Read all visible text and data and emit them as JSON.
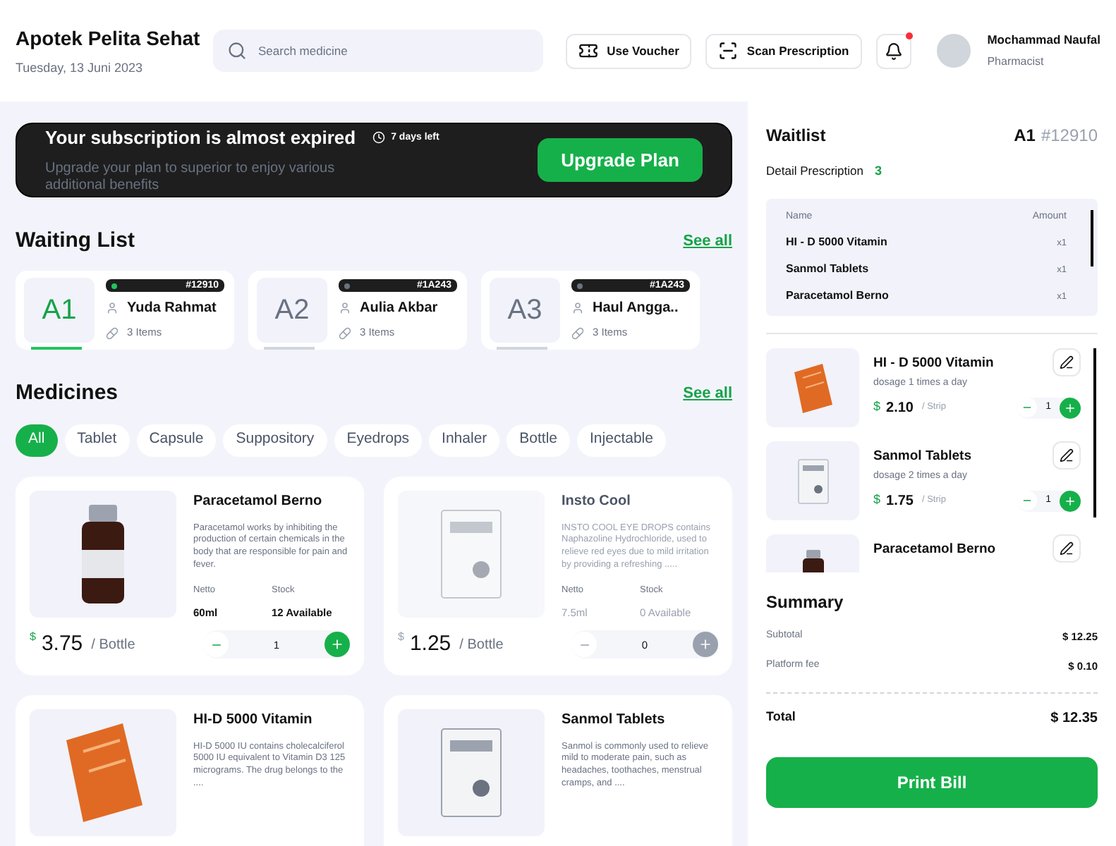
{
  "header": {
    "title": "Apotek Pelita Sehat",
    "date": "Tuesday, 13 Juni 2023",
    "search": {
      "placeholder": "Search medicine"
    },
    "buttons": [
      {
        "kind": "voucher",
        "label": "Use Voucher"
      },
      {
        "kind": "scan",
        "label": "Scan Prescription"
      }
    ],
    "notification": {
      "unread": true
    },
    "user": {
      "name": "Mochammad Naufal",
      "role": "Pharmacist"
    }
  },
  "banner": {
    "title": "Your subscription is almost expired",
    "days_left": "7 days left",
    "text": "Upgrade your plan to superior to enjoy various additional benefits",
    "button": "Upgrade Plan"
  },
  "waiting_list": {
    "title": "Waiting List",
    "see_all": "See all",
    "items": [
      {
        "queue": "A1",
        "code": "#12910",
        "name": "Yuda Rahmat",
        "items": "3 Items",
        "selected": true,
        "color": "#22c55e"
      },
      {
        "queue": "A2",
        "code": "#1A243",
        "name": "Aulia Akbar",
        "items": "3 Items",
        "selected": false,
        "color": "#6b7280"
      },
      {
        "queue": "A3",
        "code": "#1A243",
        "name": "Haul Angga..",
        "items": "3 Items",
        "selected": false,
        "color": "#6b7280"
      }
    ]
  },
  "medicines": {
    "title": "Medicines",
    "see_all": "See all",
    "categories": [
      {
        "label": "All",
        "selected": true
      },
      {
        "label": "Tablet",
        "selected": false
      },
      {
        "label": "Capsule",
        "selected": false
      },
      {
        "label": "Suppository",
        "selected": false
      },
      {
        "label": "Eyedrops",
        "selected": false
      },
      {
        "label": "Inhaler",
        "selected": false
      },
      {
        "label": "Bottle",
        "selected": false
      },
      {
        "label": "Injectable",
        "selected": false
      }
    ],
    "items": [
      {
        "kind": "bottle",
        "name": "Paracetamol Berno",
        "description": "Paracetamol works by inhibiting the production of certain chemicals in the body that are responsible for pain and fever.",
        "netto_label": "Netto",
        "netto": "60ml",
        "stock_label": "Stock",
        "stock": "12 Available",
        "currency": "$",
        "price": "3.75",
        "unit": "/ Bottle",
        "quantity": "1",
        "available": true
      },
      {
        "kind": "box",
        "name": "Insto Cool",
        "description": "INSTO COOL EYE DROPS contains Naphazoline Hydrochloride, used to relieve red eyes due to mild irritation by providing a refreshing .....",
        "netto_label": "Netto",
        "netto": "7.5ml",
        "stock_label": "Stock",
        "stock": "0 Available",
        "currency": "$",
        "price": "1.25",
        "unit": "/ Bottle",
        "quantity": "0",
        "available": false
      },
      {
        "kind": "sachet",
        "name": "HI-D 5000 Vitamin",
        "description": "HI-D 5000 IU contains cholecalciferol 5000 IU equivalent to Vitamin D3 125 micrograms. The drug belongs to the ....",
        "available": true
      },
      {
        "kind": "box",
        "name": "Sanmol Tablets",
        "description": "Sanmol is commonly used to relieve mild to moderate pain, such as headaches, toothaches, menstrual cramps, and ....",
        "available": true
      }
    ]
  },
  "waitlist_panel": {
    "title": "Waitlist",
    "queue": "A1",
    "code": "#12910",
    "detail_label": "Detail Prescription",
    "detail_count": "3",
    "columns": [
      "Name",
      "Amount"
    ],
    "rows": [
      {
        "name": "HI - D 5000 Vitamin",
        "amount": "x1"
      },
      {
        "name": "Sanmol Tablets",
        "amount": "x1"
      },
      {
        "name": "Paracetamol Berno",
        "amount": "x1"
      }
    ],
    "cart": [
      {
        "kind": "sachet",
        "name": "HI - D 5000 Vitamin",
        "dosage": "dosage 1 times a day",
        "currency": "$",
        "price": "2.10",
        "unit": "/ Strip",
        "quantity": "1"
      },
      {
        "kind": "box",
        "name": "Sanmol Tablets",
        "dosage": "dosage 2 times a day",
        "currency": "$",
        "price": "1.75",
        "unit": "/ Strip",
        "quantity": "1"
      },
      {
        "kind": "bottle",
        "name": "Paracetamol Berno"
      }
    ]
  },
  "summary": {
    "title": "Summary",
    "lines": [
      {
        "label": "Subtotal",
        "value": "$ 12.25"
      },
      {
        "label": "Platform fee",
        "value": "$ 0.10"
      }
    ],
    "total_label": "Total",
    "total": "$ 12.35",
    "button": "Print Bill"
  }
}
